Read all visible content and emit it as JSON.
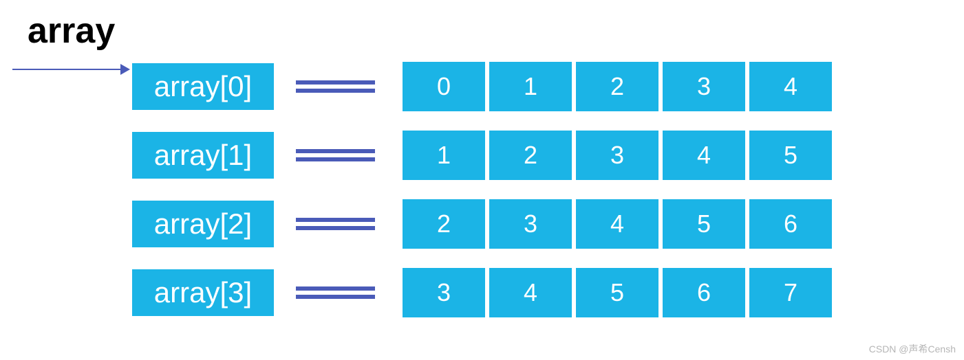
{
  "title": "array",
  "rows": [
    {
      "label": "array[0]",
      "values": [
        "0",
        "1",
        "2",
        "3",
        "4"
      ]
    },
    {
      "label": "array[1]",
      "values": [
        "1",
        "2",
        "3",
        "4",
        "5"
      ]
    },
    {
      "label": "array[2]",
      "values": [
        "2",
        "3",
        "4",
        "5",
        "6"
      ]
    },
    {
      "label": "array[3]",
      "values": [
        "3",
        "4",
        "5",
        "6",
        "7"
      ]
    }
  ],
  "watermark": "CSDN @声希Censh"
}
